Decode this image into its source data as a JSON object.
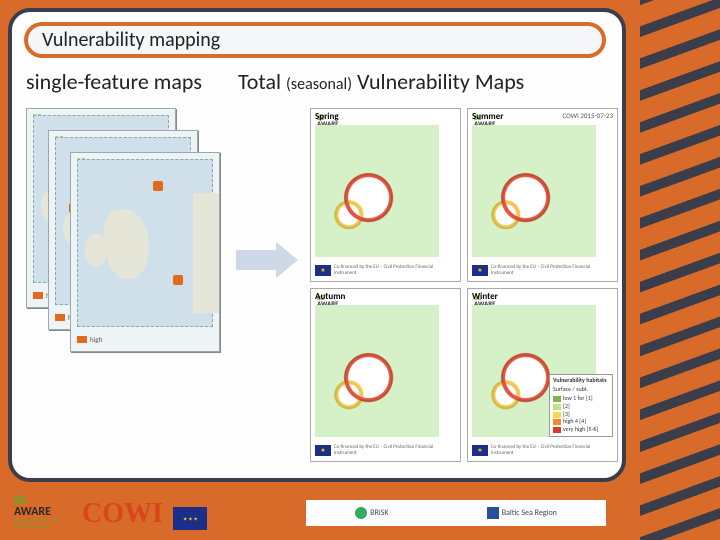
{
  "header": {
    "title": "Vulnerability mapping"
  },
  "subtitle": {
    "left": "single-feature maps",
    "right_a": "Total ",
    "right_paren": "(seasonal)",
    "right_b": " Vulnerability Maps"
  },
  "stack_maps": {
    "brand_top": "BE",
    "brand_bottom": "AWARE",
    "legend_label": "high"
  },
  "seasonal": {
    "brand_top": "BE",
    "brand_bottom": "AWARE",
    "datestamp": "COWI 2015-07-23",
    "seasons": [
      "Spring",
      "Summer",
      "Autumn",
      "Winter"
    ],
    "legend": {
      "title": "Vulnerability habitats",
      "subtitle": "Surface / subt.",
      "items": [
        {
          "label": "low 1 for [1]",
          "cls": "green"
        },
        {
          "label": "[2]",
          "cls": "lime"
        },
        {
          "label": "[3]",
          "cls": "yel"
        },
        {
          "label": "high 4 [4]",
          "cls": "or"
        },
        {
          "label": "very high [5-6]",
          "cls": "rd"
        }
      ]
    },
    "eu_text": "Co-financed by the EU – Civil Protection Financial Instrument"
  },
  "footer": {
    "beaware_top": "BE",
    "beaware_bottom": "AWARE",
    "beaware_sub": "Bonn Agreement: Area-Wide Assessment",
    "cowi": "COWI",
    "partners": [
      "BRiSK",
      "Baltic Sea Region"
    ]
  }
}
